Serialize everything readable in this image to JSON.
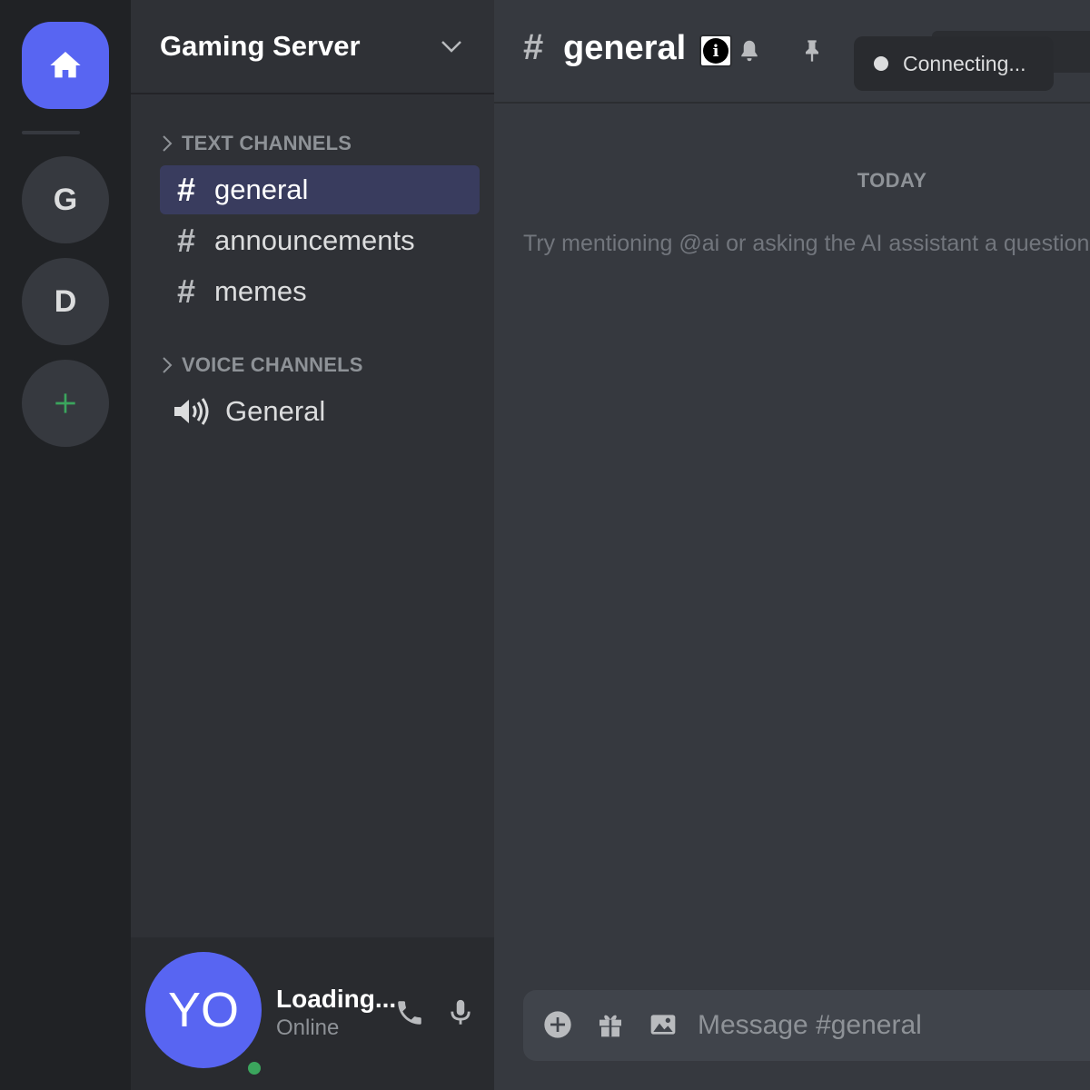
{
  "servers": {
    "home": "home-icon",
    "items": [
      {
        "label": "G"
      },
      {
        "label": "D"
      }
    ],
    "add": "+"
  },
  "sidebar": {
    "server_name": "Gaming Server",
    "text_category": "TEXT CHANNELS",
    "text_channels": [
      {
        "hash": "#",
        "name": "general"
      },
      {
        "hash": "#",
        "name": "announcements"
      },
      {
        "hash": "#",
        "name": "memes"
      }
    ],
    "voice_category": "VOICE CHANNELS",
    "voice_channels": [
      {
        "name": "General"
      }
    ]
  },
  "user": {
    "initials": "YO",
    "name": "Loading...",
    "status": "Online"
  },
  "chat": {
    "hash": "#",
    "channel": "general",
    "info_glyph": "i",
    "connection": "Connecting...",
    "date_divider": "TODAY",
    "hint": "Try mentioning @ai or asking the AI assistant a question",
    "placeholder": "Message #general"
  },
  "colors": {
    "accent": "#5865f2",
    "online": "#3ba55d",
    "rail": "#202225",
    "sidebar": "#2f3136",
    "main": "#36393f"
  }
}
